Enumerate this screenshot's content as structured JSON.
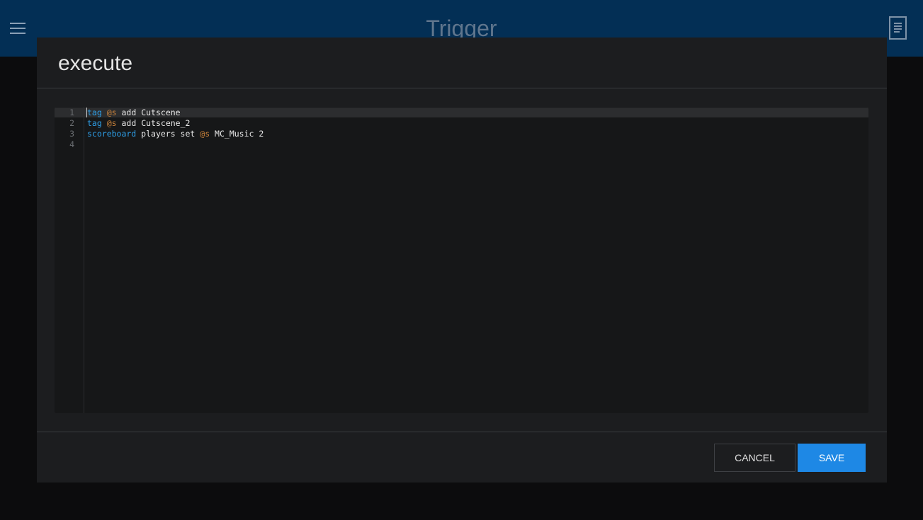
{
  "header": {
    "title": "Trigger",
    "menu_icon": "hamburger-menu-icon",
    "doc_icon": "document-icon"
  },
  "dialog": {
    "title": "execute",
    "editor": {
      "lines": [
        {
          "number": "1",
          "tokens": [
            {
              "text": "tag",
              "kind": "keyword"
            },
            {
              "text": " ",
              "kind": "plain"
            },
            {
              "text": "@s",
              "kind": "selector"
            },
            {
              "text": " add Cutscene",
              "kind": "plain"
            }
          ]
        },
        {
          "number": "2",
          "tokens": [
            {
              "text": "tag",
              "kind": "keyword"
            },
            {
              "text": " ",
              "kind": "plain"
            },
            {
              "text": "@s",
              "kind": "selector"
            },
            {
              "text": " add Cutscene_2",
              "kind": "plain"
            }
          ]
        },
        {
          "number": "3",
          "tokens": [
            {
              "text": "scoreboard",
              "kind": "keyword"
            },
            {
              "text": " players set ",
              "kind": "plain"
            },
            {
              "text": "@s",
              "kind": "selector"
            },
            {
              "text": " MC_Music 2",
              "kind": "plain"
            }
          ]
        },
        {
          "number": "4",
          "tokens": []
        }
      ]
    },
    "buttons": {
      "cancel": "CANCEL",
      "save": "SAVE"
    }
  },
  "colors": {
    "header_bg": "#032f55",
    "dialog_bg": "#1c1d1f",
    "accent": "#1e88e5",
    "keyword": "#2e9fe8",
    "selector": "#c9823a"
  }
}
